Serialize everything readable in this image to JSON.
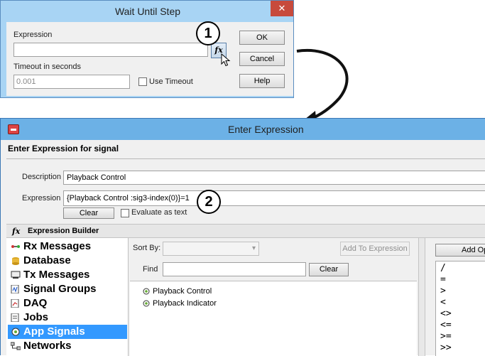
{
  "wait_dialog": {
    "title": "Wait Until Step",
    "close_glyph": "✕",
    "expression_label": "Expression",
    "expression_value": "",
    "fx_label": "fx",
    "timeout_label": "Timeout in seconds",
    "timeout_value": "0.001",
    "use_timeout_label": "Use Timeout",
    "use_timeout_checked": false,
    "ok_label": "OK",
    "cancel_label": "Cancel",
    "help_label": "Help"
  },
  "callouts": {
    "one": "1",
    "two": "2"
  },
  "expr_window": {
    "title": "Enter Expression",
    "header": "Enter Expression for signal",
    "description_label": "Description",
    "description_value": "Playback Control",
    "expression_label": "Expression",
    "expression_value": "{Playback Control :sig3-index(0)}=1",
    "clear_label": "Clear",
    "evaluate_label": "Evaluate as text",
    "evaluate_checked": false
  },
  "builder": {
    "fx_label": "fx",
    "title": "Expression Builder",
    "tree": [
      {
        "label": "Rx Messages",
        "icon": "rx-messages-icon"
      },
      {
        "label": "Database",
        "icon": "database-icon"
      },
      {
        "label": "Tx Messages",
        "icon": "tx-messages-icon"
      },
      {
        "label": "Signal Groups",
        "icon": "signal-groups-icon"
      },
      {
        "label": "DAQ",
        "icon": "daq-icon"
      },
      {
        "label": "Jobs",
        "icon": "jobs-icon"
      },
      {
        "label": "App Signals",
        "icon": "app-signals-icon",
        "selected": true
      },
      {
        "label": "Networks",
        "icon": "networks-icon"
      }
    ],
    "sort_by_label": "Sort By:",
    "sort_by_value": "",
    "add_to_expression_label": "Add To Expression",
    "find_label": "Find",
    "find_value": "",
    "find_clear_label": "Clear",
    "signals": [
      "Playback Control",
      "Playback Indicator"
    ],
    "add_op_label": "Add Op",
    "operators": [
      "/",
      "=",
      ">",
      "<",
      "<>",
      "<=",
      ">=",
      ">>"
    ]
  },
  "colors": {
    "titlebar_blue": "#6cb1e6",
    "selection": "#3399ff",
    "close_red": "#c74a3c"
  }
}
